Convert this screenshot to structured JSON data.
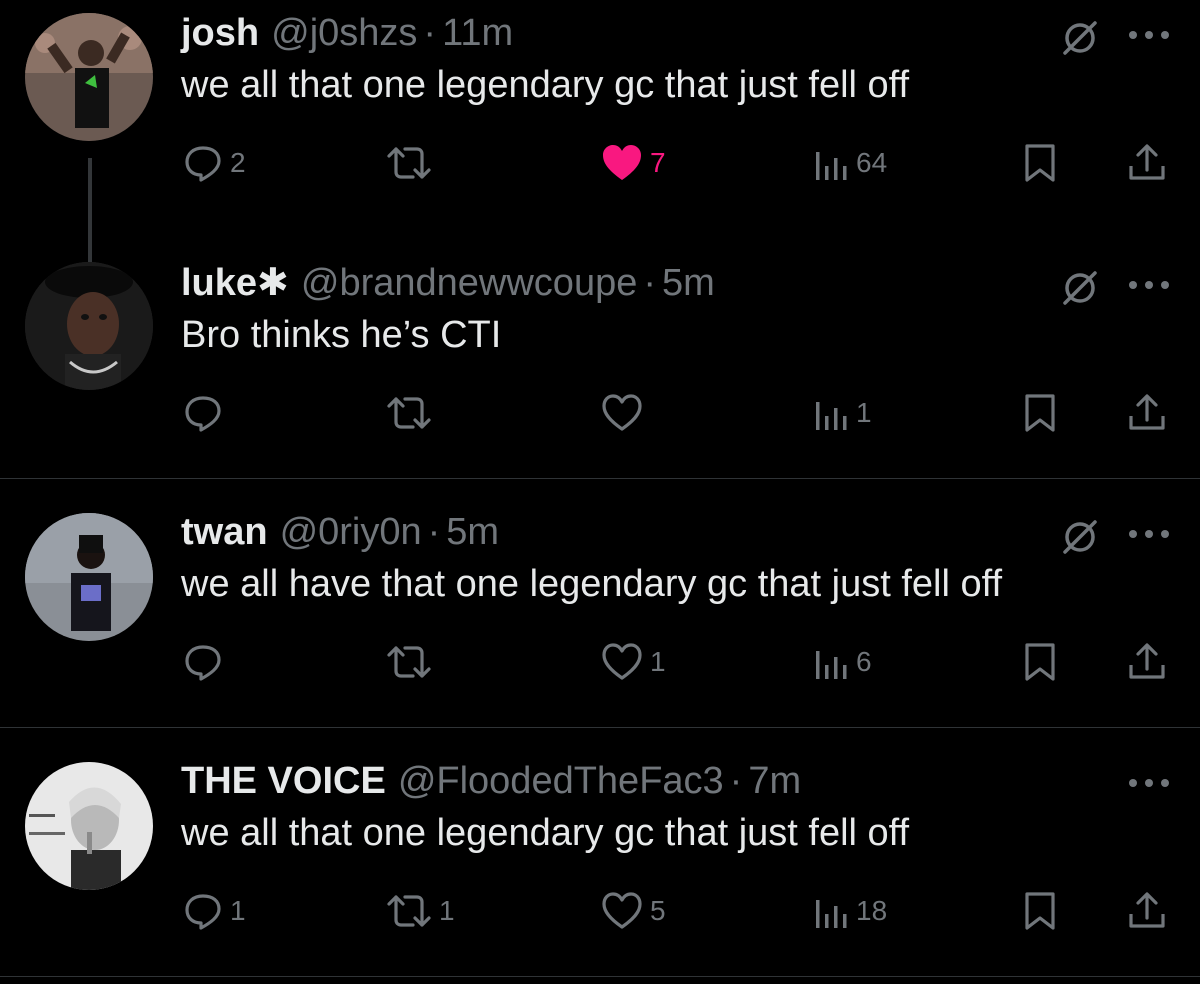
{
  "tweets": [
    {
      "name": "josh",
      "handle": "@j0shzs",
      "separator": "·",
      "time": "11m",
      "text": "we all that one legendary gc that just fell off",
      "replies": "2",
      "retweets": "",
      "likes": "7",
      "liked": true,
      "views": "64",
      "muted_icon": true
    },
    {
      "name": "luke✱",
      "handle": "@brandnewwcoupe",
      "separator": "·",
      "time": "5m",
      "text": "Bro thinks he’s CTI",
      "replies": "",
      "retweets": "",
      "likes": "",
      "liked": false,
      "views": "1",
      "muted_icon": true
    },
    {
      "name": "twan",
      "handle": "@0riy0n",
      "separator": "·",
      "time": "5m",
      "text": "we all have that one legendary gc that just fell off",
      "replies": "",
      "retweets": "",
      "likes": "1",
      "liked": false,
      "views": "6",
      "muted_icon": true
    },
    {
      "name": "THE VOICE",
      "handle": "@FloodedTheFac3",
      "separator": "·",
      "time": "7m",
      "text": "we all that one legendary gc that just fell off",
      "replies": "1",
      "retweets": "1",
      "likes": "5",
      "liked": false,
      "views": "18",
      "muted_icon": false
    }
  ],
  "icons": {
    "reply": "reply-icon",
    "retweet": "retweet-icon",
    "like": "heart-icon",
    "views": "views-icon",
    "bookmark": "bookmark-icon",
    "share": "share-icon",
    "mute": "mute-icon",
    "more": "more-icon"
  },
  "colors": {
    "background": "#000000",
    "text": "#e7e9ea",
    "muted": "#71767b",
    "like_active": "#f91880",
    "divider": "#2f3336"
  }
}
